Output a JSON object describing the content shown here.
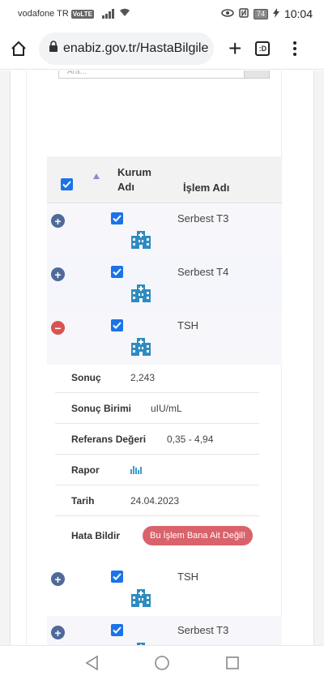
{
  "status_bar": {
    "carrier": "vodafone TR",
    "volte": "VoLTE",
    "battery": "74",
    "time": "10:04"
  },
  "browser": {
    "url": "enabiz.gov.tr/HastaBilgile",
    "tab_count": ":D"
  },
  "search": {
    "placeholder": "Ara..."
  },
  "table": {
    "col_kurum": "Kurum Adı",
    "col_islem": "İşlem Adı",
    "rows": [
      {
        "name": "Serbest T3",
        "expanded": false
      },
      {
        "name": "Serbest T4",
        "expanded": false
      },
      {
        "name": "TSH",
        "expanded": true
      },
      {
        "name": "TSH",
        "expanded": false
      },
      {
        "name": "Serbest T3",
        "expanded": false
      }
    ]
  },
  "detail": {
    "sonuc_label": "Sonuç",
    "sonuc_value": "2,243",
    "birim_label": "Sonuç Birimi",
    "birim_value": "uIU/mL",
    "referans_label": "Referans Değeri",
    "referans_value": "0,35 - 4,94",
    "rapor_label": "Rapor",
    "tarih_label": "Tarih",
    "tarih_value": "24.04.2023",
    "hata_label": "Hata Bildir",
    "hata_button": "Bu İşlem Bana Ait Değil!"
  },
  "colors": {
    "accent": "#1a73e8",
    "danger": "#d9534f",
    "toggle": "#4e6a99"
  }
}
